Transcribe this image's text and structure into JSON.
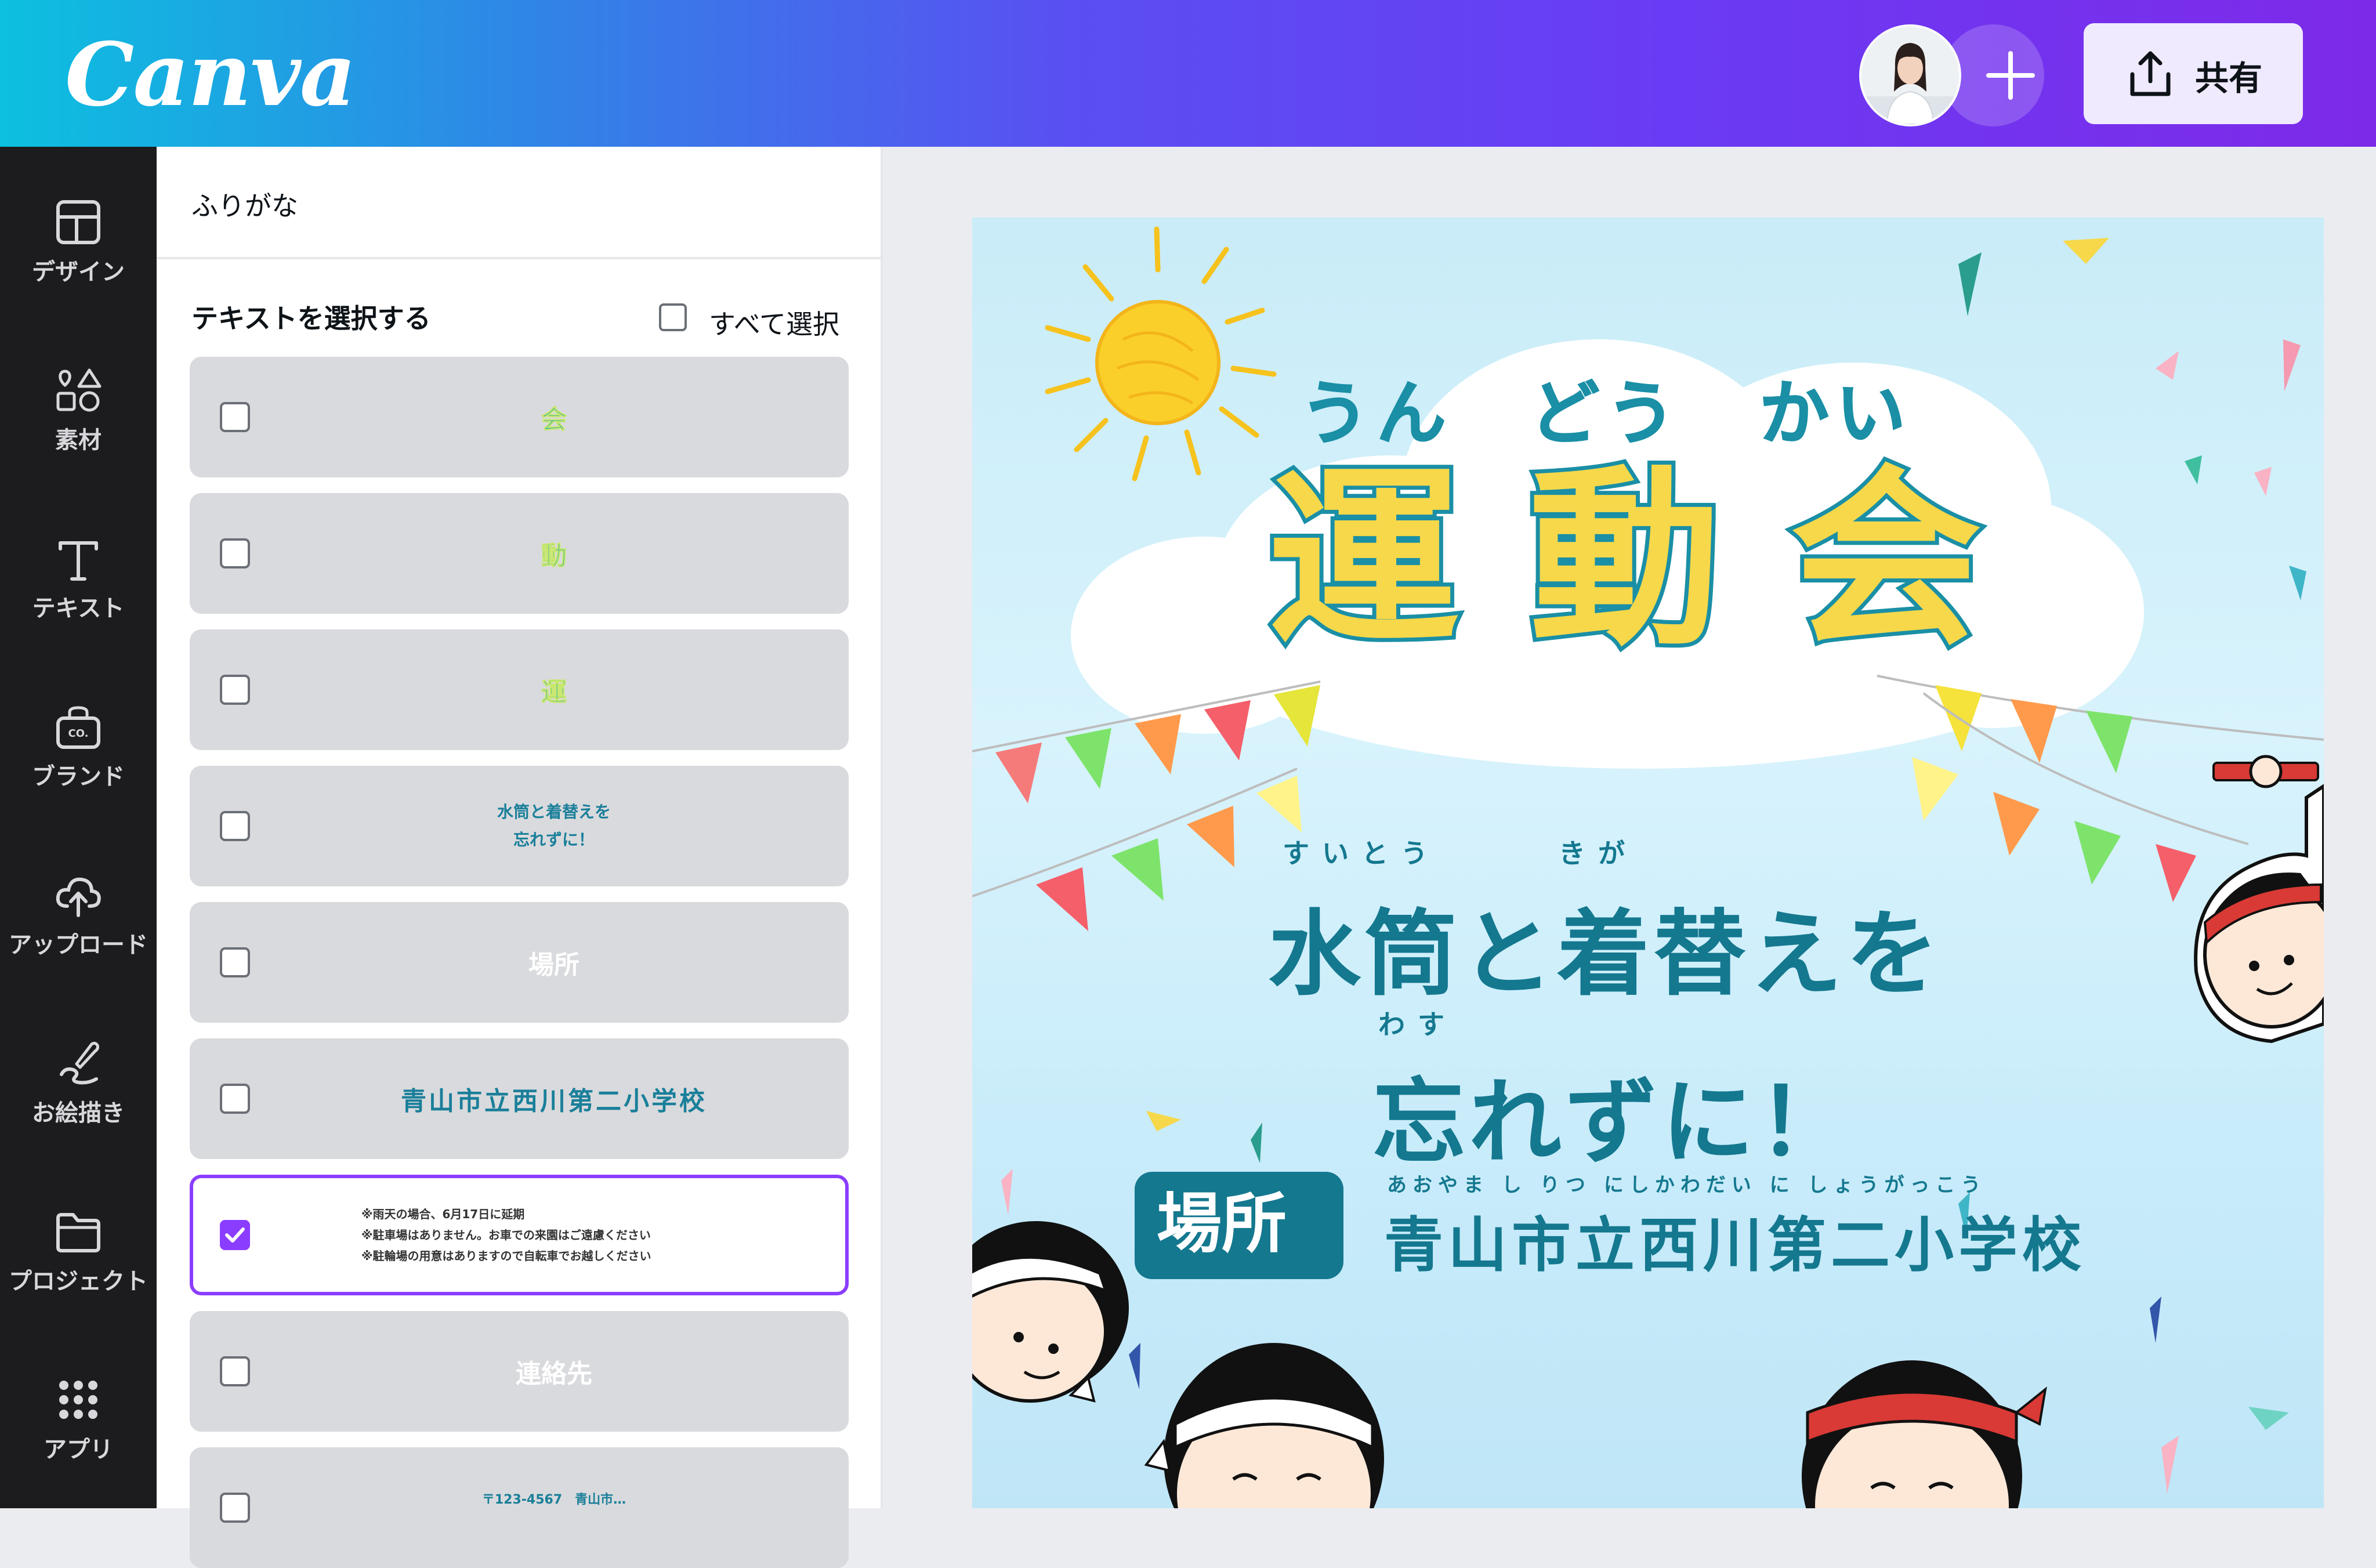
{
  "app": {
    "logo_text": "Canva"
  },
  "header": {
    "share_label": "共有"
  },
  "nav": [
    {
      "label": "デザイン",
      "icon": "layout-icon"
    },
    {
      "label": "素材",
      "icon": "shapes-icon"
    },
    {
      "label": "テキスト",
      "icon": "text-icon"
    },
    {
      "label": "ブランド",
      "icon": "brand-icon"
    },
    {
      "label": "アップロード",
      "icon": "upload-cloud-icon"
    },
    {
      "label": "お絵描き",
      "icon": "draw-icon"
    },
    {
      "label": "プロジェクト",
      "icon": "folder-icon"
    },
    {
      "label": "アプリ",
      "icon": "apps-grid-icon"
    }
  ],
  "panel": {
    "title": "ふりがな",
    "select_heading": "テキストを選択する",
    "select_all_label": "すべて選択",
    "items": [
      {
        "lines": [
          "会"
        ],
        "checked": false,
        "color": "#1aa3b8"
      },
      {
        "lines": [
          "動"
        ],
        "checked": false,
        "color": "#1aa3b8"
      },
      {
        "lines": [
          "運"
        ],
        "checked": false,
        "color": "#1aa3b8"
      },
      {
        "lines": [
          "水筒と着替えを",
          "忘れずに！"
        ],
        "checked": false,
        "color": "#1a7f9a"
      },
      {
        "lines": [
          "場所"
        ],
        "checked": false,
        "color": "#ffffff"
      },
      {
        "lines": [
          "青山市立西川第二小学校"
        ],
        "checked": false,
        "color": "#1a7f9a"
      },
      {
        "lines": [
          "※雨天の場合、6月17日に延期",
          "※駐車場はありません。お車での来園はご遠慮ください",
          "※駐輪場の用意はありますので自転車でお越しください"
        ],
        "checked": true,
        "color": "#333333"
      },
      {
        "lines": [
          "連絡先"
        ],
        "checked": false,
        "color": "#ffffff"
      },
      {
        "lines": [
          "〒123-4567　青山市…"
        ],
        "checked": false,
        "color": "#1a7f9a"
      }
    ]
  },
  "poster": {
    "ruby_title": "うん　どう　かい",
    "title_chars": [
      "運",
      "動",
      "会"
    ],
    "ruby_line1": "すいとう　　　きが",
    "line1": "水筒と着替えを",
    "ruby_line2": "わす",
    "line2": "忘れずに！",
    "place_badge": "場所",
    "ruby_school": "あおやま し りつ にしかわだい に しょうがっこう",
    "school": "青山市立西川第二小学校",
    "colors": {
      "teal": "#1a8fa6",
      "yellow": "#f6d84a",
      "dark_teal": "#14788f"
    }
  }
}
